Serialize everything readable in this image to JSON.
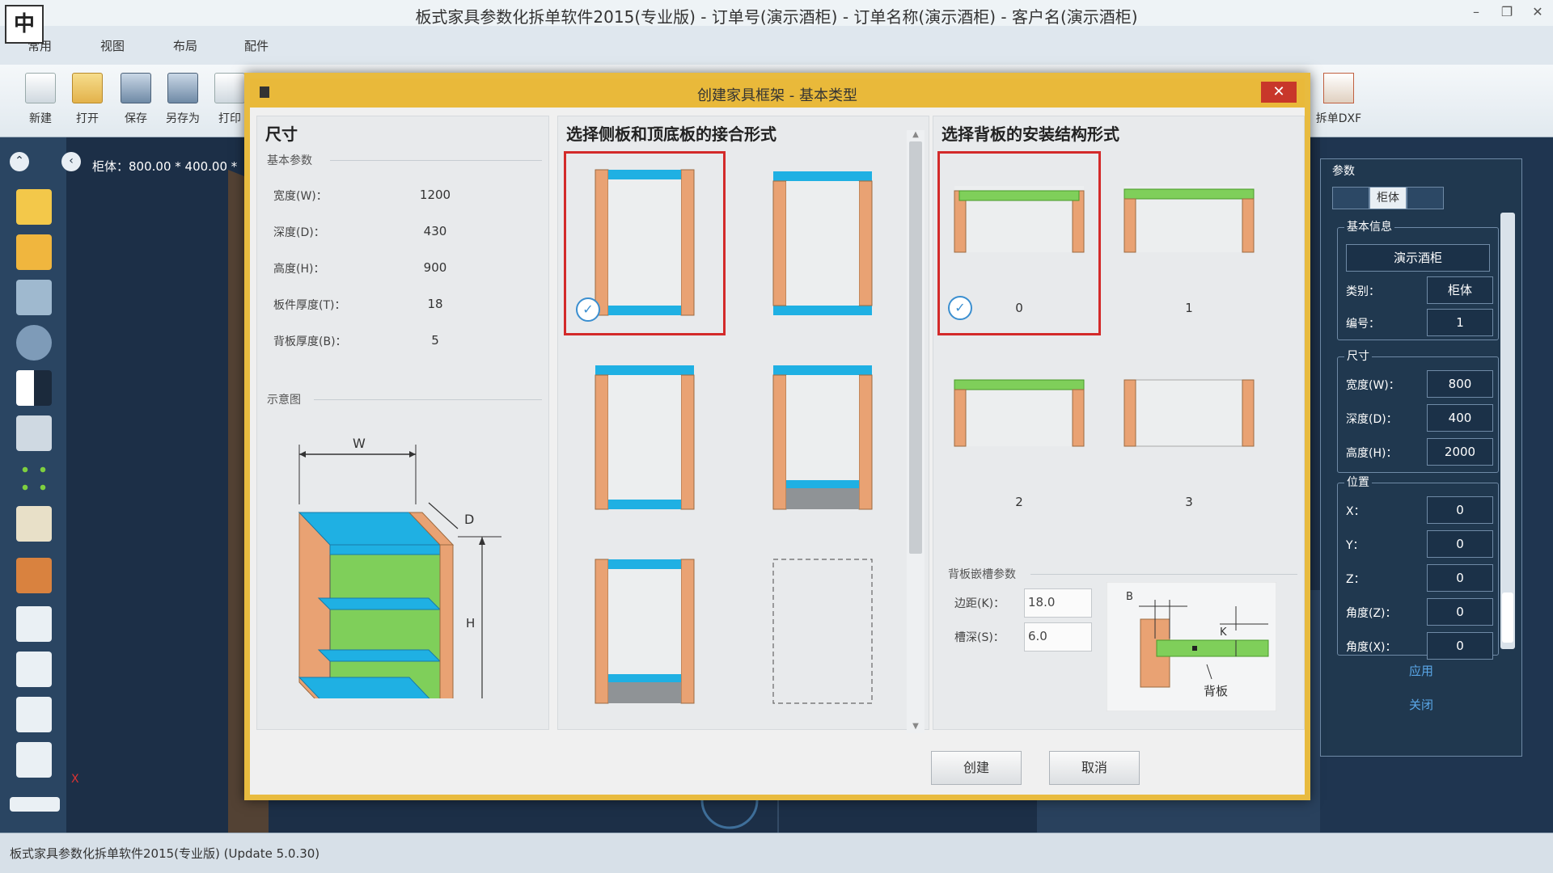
{
  "window": {
    "logo_char": "中",
    "title": "板式家具参数化拆单软件2015(专业版) - 订单号(演示酒柜) - 订单名称(演示酒柜) - 客户名(演示酒柜)",
    "minimize": "–",
    "restore": "❐",
    "close": "✕"
  },
  "ribbon": {
    "tabs": [
      "常用",
      "视图",
      "布局",
      "配件"
    ],
    "buttons": [
      "新建",
      "打开",
      "保存",
      "另存为",
      "打印"
    ],
    "dxf_button": "拆单DXF"
  },
  "workspace": {
    "readout": "柜体：800.00 * 400.00 *",
    "axis_label": "X"
  },
  "right_panel": {
    "title": "参数",
    "tabs": [
      "",
      "柜体",
      ""
    ],
    "basic_group": "基本信息",
    "name": "演示酒柜",
    "category_label": "类别：",
    "category_value": "柜体",
    "number_label": "编号：",
    "number_value": "1",
    "size_group": "尺寸",
    "width_label": "宽度(W)：",
    "width_value": "800",
    "depth_label": "深度(D)：",
    "depth_value": "400",
    "height_label": "高度(H)：",
    "height_value": "2000",
    "pos_group": "位置",
    "x_label": "X：",
    "x_value": "0",
    "y_label": "Y：",
    "y_value": "0",
    "z_label": "Z：",
    "z_value": "0",
    "angle_z_label": "角度(Z)：",
    "angle_z_value": "0",
    "angle_x_label": "角度(X)：",
    "angle_x_value": "0",
    "apply": "应用",
    "close": "关闭"
  },
  "status_bar": "板式家具参数化拆单软件2015(专业版) (Update 5.0.30)",
  "dialog": {
    "title": "创建家具框架 - 基本类型",
    "close": "✕",
    "size_panel": {
      "heading": "尺寸",
      "basic_params": "基本参数",
      "params": [
        {
          "label": "宽度(W)：",
          "value": "1200"
        },
        {
          "label": "深度(D)：",
          "value": "430"
        },
        {
          "label": "高度(H)：",
          "value": "900"
        },
        {
          "label": "板件厚度(T)：",
          "value": "18"
        },
        {
          "label": "背板厚度(B)：",
          "value": "5"
        }
      ],
      "diagram_label": "示意图",
      "dim_w": "W",
      "dim_d": "D",
      "dim_h": "H"
    },
    "joint_panel": {
      "heading": "选择侧板和顶底板的接合形式",
      "selected_index": 0
    },
    "back_panel": {
      "heading": "选择背板的安装结构形式",
      "option_labels": [
        "0",
        "1",
        "2",
        "3"
      ],
      "selected_index": 0,
      "groove_params": "背板嵌槽参数",
      "margin_label": "边距(K)：",
      "margin_value": "18.0",
      "groove_label": "槽深(S)：",
      "groove_value": "6.0",
      "diagram_b": "B",
      "diagram_k": "K",
      "diagram_back": "背板"
    },
    "create": "创建",
    "cancel": "取消"
  },
  "colors": {
    "dialog_border": "#e8bb3f",
    "panel_board": "#e9a273",
    "top_board": "#1fb0e3",
    "back_board": "#7fcf5a",
    "selected": "#d32a2a"
  }
}
